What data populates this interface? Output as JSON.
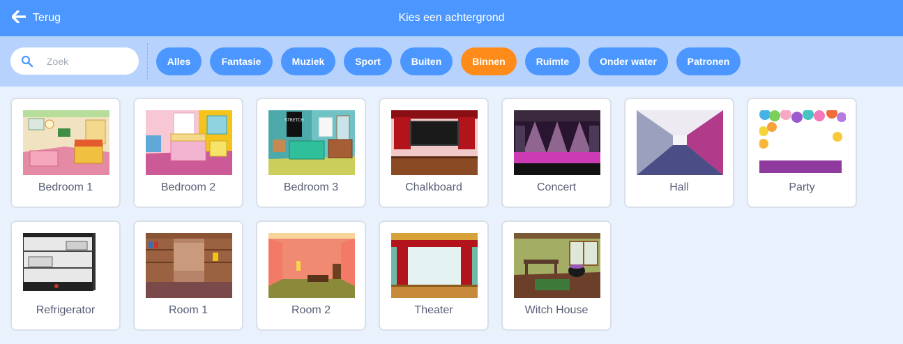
{
  "header": {
    "back_label": "Terug",
    "title": "Kies een achtergrond"
  },
  "search": {
    "placeholder": "Zoek"
  },
  "tags": [
    {
      "label": "Alles",
      "active": false
    },
    {
      "label": "Fantasie",
      "active": false
    },
    {
      "label": "Muziek",
      "active": false
    },
    {
      "label": "Sport",
      "active": false
    },
    {
      "label": "Buiten",
      "active": false
    },
    {
      "label": "Binnen",
      "active": true
    },
    {
      "label": "Ruimte",
      "active": false
    },
    {
      "label": "Onder water",
      "active": false
    },
    {
      "label": "Patronen",
      "active": false
    }
  ],
  "backdrops": [
    {
      "name": "Bedroom 1"
    },
    {
      "name": "Bedroom 2"
    },
    {
      "name": "Bedroom 3"
    },
    {
      "name": "Chalkboard"
    },
    {
      "name": "Concert"
    },
    {
      "name": "Hall"
    },
    {
      "name": "Party"
    },
    {
      "name": "Refrigerator"
    },
    {
      "name": "Room 1"
    },
    {
      "name": "Room 2"
    },
    {
      "name": "Theater"
    },
    {
      "name": "Witch House"
    }
  ],
  "colors": {
    "primary": "#4c97ff",
    "active_tag": "#ff8c1a",
    "filter_bar": "#b7d3fd",
    "background": "#e9f1fc"
  }
}
